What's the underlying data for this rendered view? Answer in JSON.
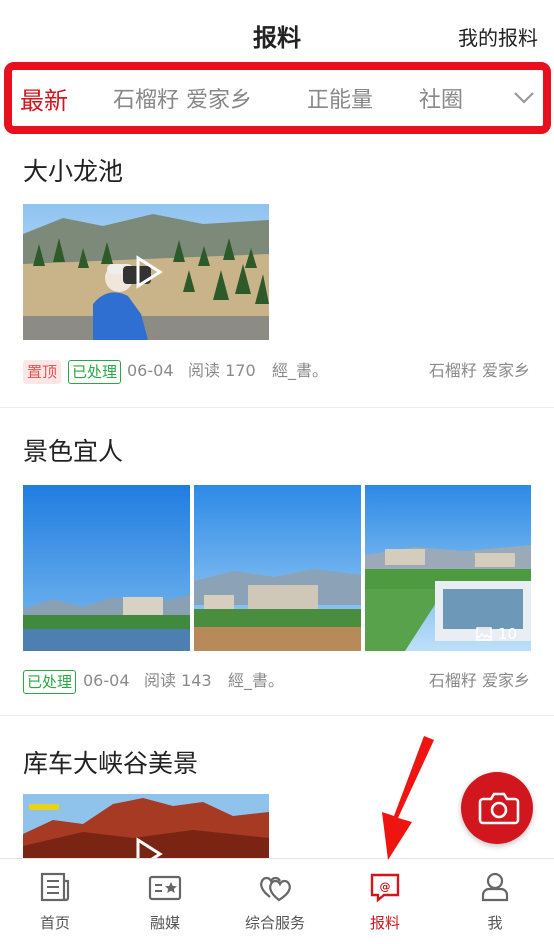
{
  "header": {
    "title": "报料",
    "my_reports": "我的报料"
  },
  "tabs": [
    {
      "label": "最新",
      "active": true
    },
    {
      "label": "石榴籽 爱家乡",
      "active": false
    },
    {
      "label": "正能量",
      "active": false
    },
    {
      "label": "社圈",
      "active": false
    }
  ],
  "posts": [
    {
      "title": "大小龙池",
      "badge_top": "置顶",
      "badge_status": "已处理",
      "date": "06-04",
      "reads": "阅读 170",
      "author": "經_書。",
      "channel": "石榴籽 爱家乡"
    },
    {
      "title": "景色宜人",
      "badge_status": "已处理",
      "date": "06-04",
      "reads": "阅读 143",
      "author": "經_書。",
      "channel": "石榴籽 爱家乡",
      "image_count": "10"
    },
    {
      "title": "库车大峡谷美景"
    }
  ],
  "bottom_nav": [
    {
      "label": "首页",
      "icon": "newspaper-icon",
      "active": false
    },
    {
      "label": "融媒",
      "icon": "media-card-icon",
      "active": false
    },
    {
      "label": "综合服务",
      "icon": "hearts-icon",
      "active": false
    },
    {
      "label": "报料",
      "icon": "report-at-icon",
      "active": true
    },
    {
      "label": "我",
      "icon": "user-icon",
      "active": false
    }
  ],
  "colors": {
    "accent": "#d1161d",
    "done_green": "#2aa845",
    "annotation_red": "#e8101e"
  }
}
